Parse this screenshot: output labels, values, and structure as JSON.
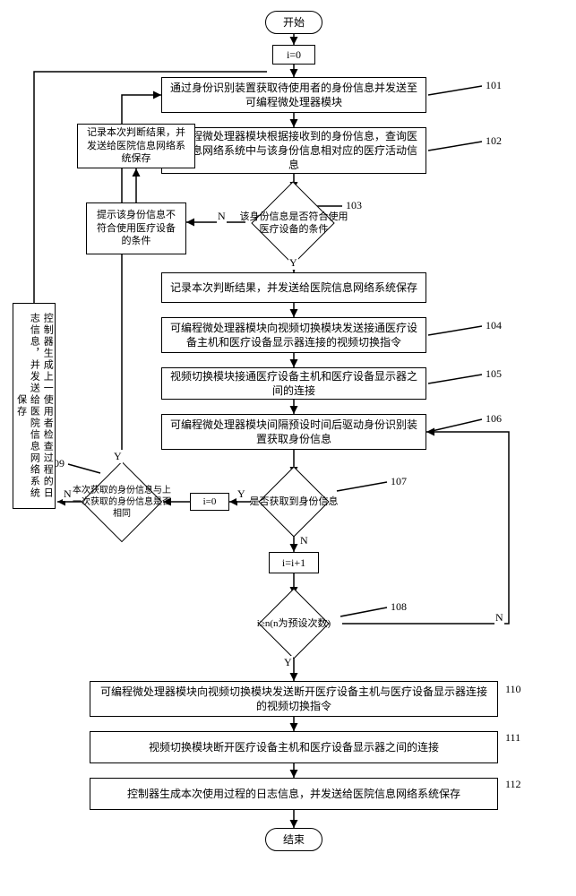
{
  "terminators": {
    "start": "开始",
    "end": "结束"
  },
  "init_counter": "i=0",
  "steps": {
    "s101": "通过身份识别装置获取待使用者的身份信息并发送至可编程微处理器模块",
    "s102": "可编程微处理器模块根据接收到的身份信息，查询医院信息网络系统中与该身份信息相对应的医疗活动信息",
    "record_after_103": "记录本次判断结果，并发送给医院信息网络系统保存",
    "s104": "可编程微处理器模块向视频切换模块发送接通医疗设备主机和医疗设备显示器连接的视频切换指令",
    "s105": "视频切换模块接通医疗设备主机和医疗设备显示器之间的连接",
    "s106": "可编程微处理器模块间隔预设时间后驱动身份识别装置获取身份信息",
    "inc_counter": "i=i+1",
    "s110": "可编程微处理器模块向视频切换模块发送断开医疗设备主机与医疗设备显示器连接的视频切换指令",
    "s111": "视频切换模块断开医疗设备主机和医疗设备显示器之间的连接",
    "s112": "控制器生成本次使用过程的日志信息，并发送给医院信息网络系统保存",
    "reset_counter": "i=0"
  },
  "decisions": {
    "d103": "该身份信息是否符合使用医疗设备的条件",
    "d107": "是否获取到身份信息",
    "d108": "i≥n(n为预设次数)",
    "d109": "本次获取的身份信息与上一次获取的身份信息是否相同"
  },
  "side_boxes": {
    "fail_hint": "提示该身份信息不符合使用医疗设备的条件",
    "record_result": "记录本次判断结果，并发送给医院信息网络系统保存",
    "controller_log_prev": "控制器生成上一使用者检查过程的日志信息，并发送给医院信息网络系统保存"
  },
  "refs": {
    "r101": "101",
    "r102": "102",
    "r103": "103",
    "r104": "104",
    "r105": "105",
    "r106": "106",
    "r107": "107",
    "r108": "108",
    "r109": "109",
    "r110": "110",
    "r111": "111",
    "r112": "112"
  },
  "labels": {
    "yes": "Y",
    "no": "N"
  }
}
